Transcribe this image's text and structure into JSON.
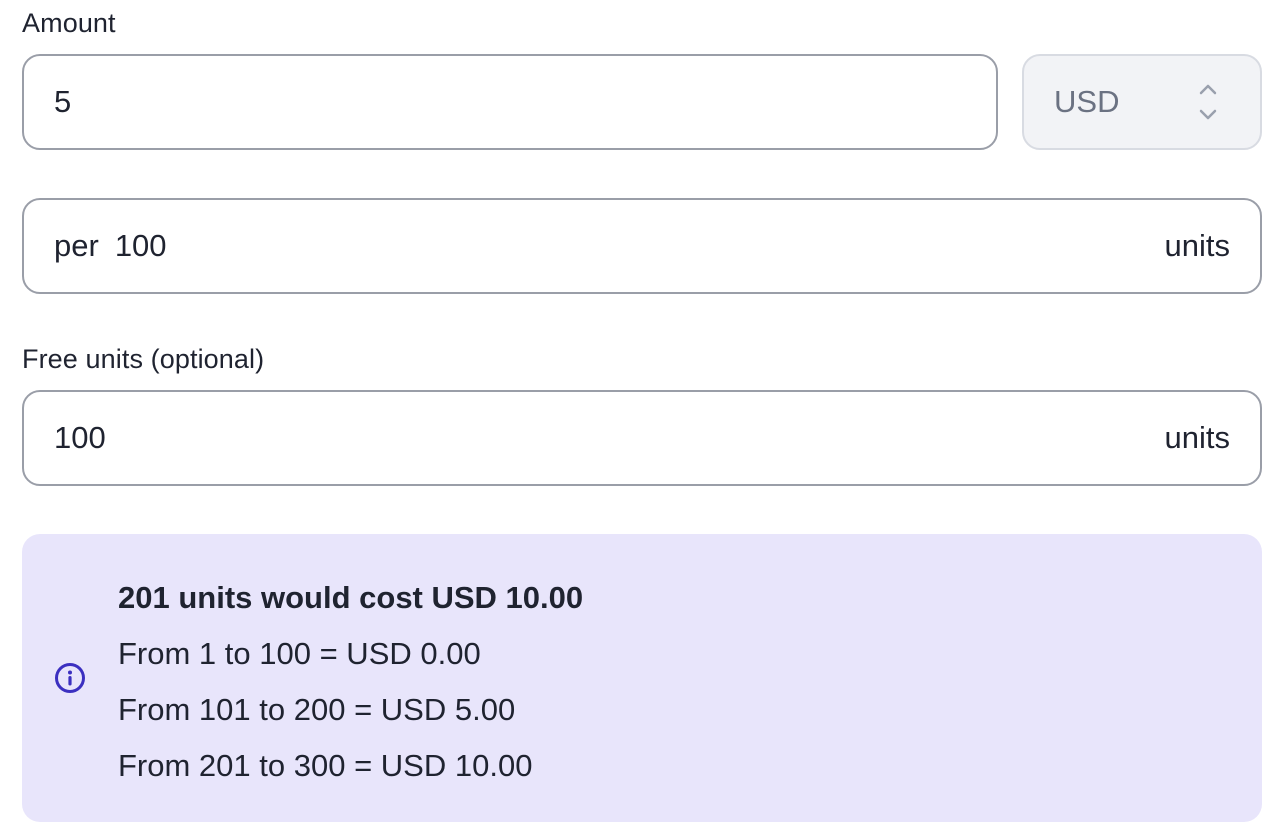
{
  "amount": {
    "label": "Amount",
    "value": "5",
    "currency": "USD"
  },
  "per": {
    "prefix": "per",
    "value": "100",
    "suffix": "units"
  },
  "free_units": {
    "label": "Free units (optional)",
    "value": "100",
    "suffix": "units"
  },
  "summary": {
    "title": "201 units would cost USD 10.00",
    "lines": [
      "From 1 to 100 = USD 0.00",
      "From 101 to 200 = USD 5.00",
      "From 201 to 300 = USD 10.00"
    ],
    "icon": "info-icon",
    "accent_color": "#3b2fc0",
    "background_color": "#e8e5fb"
  }
}
